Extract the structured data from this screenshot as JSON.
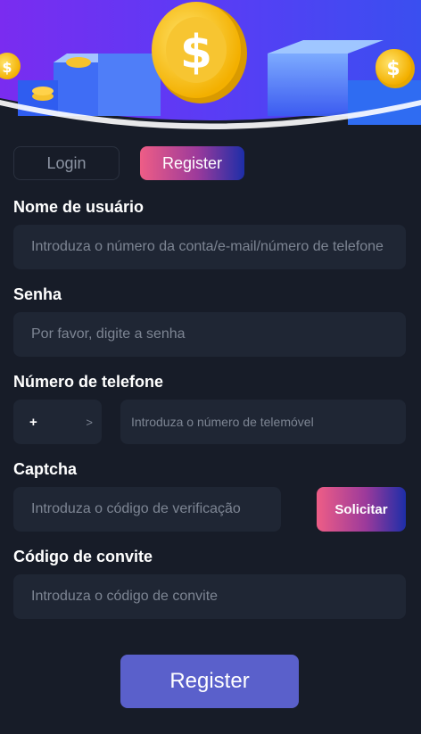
{
  "tabs": {
    "login": "Login",
    "register": "Register"
  },
  "fields": {
    "username": {
      "label": "Nome de usuário",
      "placeholder": "Introduza o número da conta/e-mail/número de telefone"
    },
    "password": {
      "label": "Senha",
      "placeholder": "Por favor, digite a senha"
    },
    "phone": {
      "label": "Número de telefone",
      "prefix": "+",
      "prefix_chevron": ">",
      "placeholder": "Introduza o número de telemóvel"
    },
    "captcha": {
      "label": "Captcha",
      "placeholder": "Introduza o código de verificação",
      "button": "Solicitar"
    },
    "invite": {
      "label": "Código de convite",
      "placeholder": "Introduza o código de convite"
    }
  },
  "submit": "Register",
  "colors": {
    "background": "#171c28",
    "field": "#1f2634",
    "submit": "#5a60cb",
    "gradient_start": "#ee5d86",
    "gradient_end": "#1d2ea8"
  }
}
